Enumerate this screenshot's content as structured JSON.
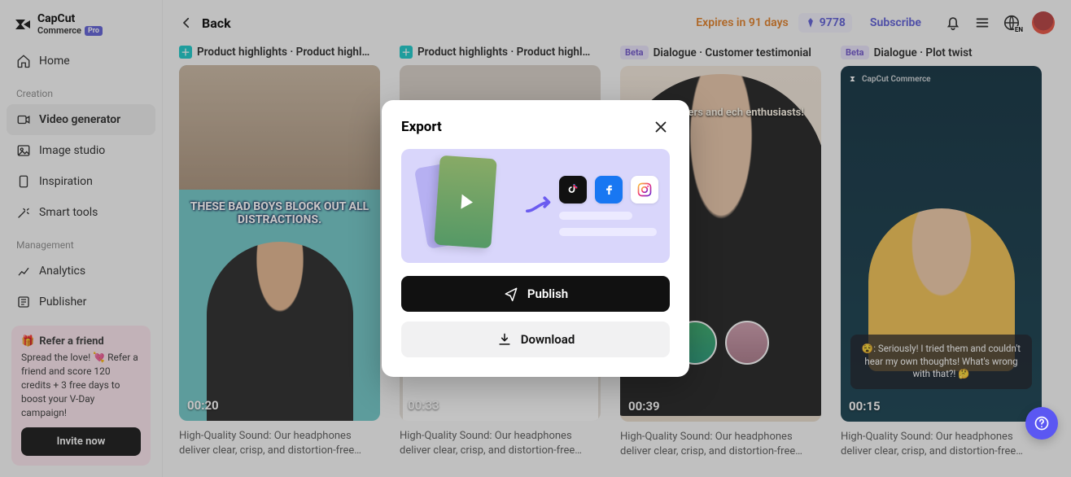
{
  "brand": {
    "name": "CapCut",
    "sub": "Commerce",
    "badge": "Pro"
  },
  "sidebar": {
    "home": "Home",
    "section_creation": "Creation",
    "items_creation": [
      {
        "label": "Video generator"
      },
      {
        "label": "Image studio"
      },
      {
        "label": "Inspiration"
      },
      {
        "label": "Smart tools"
      }
    ],
    "section_management": "Management",
    "items_management": [
      {
        "label": "Analytics"
      },
      {
        "label": "Publisher"
      }
    ],
    "refer": {
      "title": "Refer a friend",
      "body": "Spread the love! 💘 Refer a friend and score 120 credits + 3 free days to boost your V-Day campaign!",
      "cta": "Invite now"
    }
  },
  "topbar": {
    "back": "Back",
    "expires": "Expires in 91 days",
    "credits": "9778",
    "subscribe": "Subscribe",
    "lang": "EN"
  },
  "cards": [
    {
      "tag_kind": "plus",
      "tag_text": "Product highlights · Product highl…",
      "duration": "00:20",
      "caption": "THESE BAD BOYS BLOCK OUT ALL DISTRACTIONS.",
      "desc": "High-Quality Sound: Our headphones deliver clear, crisp, and distortion-free…"
    },
    {
      "tag_kind": "plus",
      "tag_text": "Product highlights · Product highl…",
      "duration": "00:33",
      "caption": "",
      "desc": "High-Quality Sound: Our headphones deliver clear, crisp, and distortion-free…"
    },
    {
      "tag_kind": "beta",
      "tag_badge": "Beta",
      "tag_text": "Dialogue · Customer testimonial",
      "duration": "00:39",
      "caption": ", music lovers and ech enthusiasts!",
      "desc": "High-Quality Sound: Our headphones deliver clear, crisp, and distortion-free…"
    },
    {
      "tag_kind": "beta",
      "tag_badge": "Beta",
      "tag_text": "Dialogue · Plot twist",
      "duration": "00:15",
      "caption": "😵: Seriously! I tried them and couldn't hear my own thoughts! What's wrong with that?! 🤔",
      "desc": "High-Quality Sound: Our headphones deliver clear, crisp, and distortion-free…"
    }
  ],
  "modal": {
    "title": "Export",
    "publish": "Publish",
    "download": "Download"
  }
}
